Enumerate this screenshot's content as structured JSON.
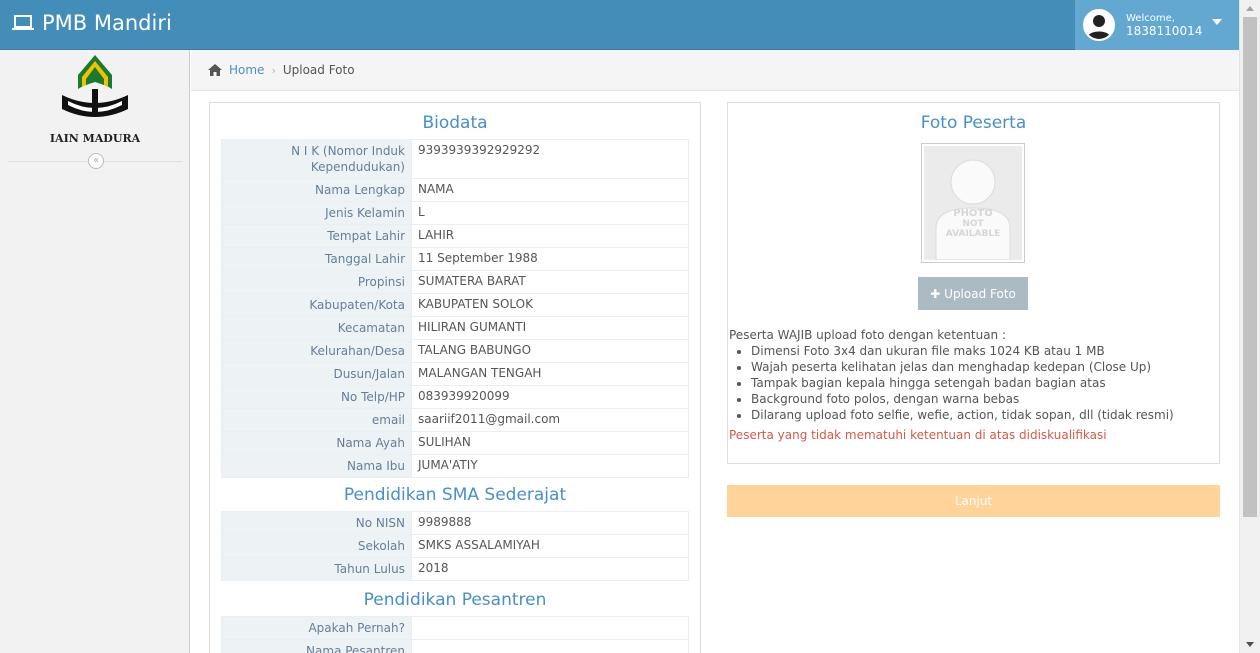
{
  "navbar": {
    "brand": "PMB Mandiri",
    "brand_icon": "laptop-icon",
    "welcome_label": "Welcome,",
    "username": "1838110014"
  },
  "sidebar": {
    "logo_text": "IAIN MADURA",
    "collapse_icon": "«"
  },
  "breadcrumb": {
    "home": "Home",
    "separator": "›",
    "current": "Upload Foto"
  },
  "biodata": {
    "title": "Biodata",
    "rows": [
      {
        "label": "N I K (Nomor Induk Kependudukan)",
        "value": "9393939392929292"
      },
      {
        "label": "Nama Lengkap",
        "value": "NAMA"
      },
      {
        "label": "Jenis Kelamin",
        "value": "L"
      },
      {
        "label": "Tempat Lahir",
        "value": "LAHIR"
      },
      {
        "label": "Tanggal Lahir",
        "value": "11 September 1988"
      },
      {
        "label": "Propinsi",
        "value": "SUMATERA BARAT"
      },
      {
        "label": "Kabupaten/Kota",
        "value": "KABUPATEN SOLOK"
      },
      {
        "label": "Kecamatan",
        "value": "HILIRAN GUMANTI"
      },
      {
        "label": "Kelurahan/Desa",
        "value": "TALANG BABUNGO"
      },
      {
        "label": "Dusun/Jalan",
        "value": "MALANGAN TENGAH"
      },
      {
        "label": "No Telp/HP",
        "value": "083939920099"
      },
      {
        "label": "email",
        "value": "saariif2011@gmail.com"
      },
      {
        "label": "Nama Ayah",
        "value": "SULIHAN"
      },
      {
        "label": "Nama Ibu",
        "value": "JUMA'ATIY"
      }
    ]
  },
  "sma": {
    "title": "Pendidikan SMA Sederajat",
    "rows": [
      {
        "label": "No NISN",
        "value": "9989888"
      },
      {
        "label": "Sekolah",
        "value": "SMKS ASSALAMIYAH"
      },
      {
        "label": "Tahun Lulus",
        "value": "2018"
      }
    ]
  },
  "pesantren": {
    "title": "Pendidikan Pesantren",
    "rows": [
      {
        "label": "Apakah Pernah?",
        "value": ""
      },
      {
        "label": "Nama Pesantren",
        "value": ""
      }
    ]
  },
  "foto": {
    "title": "Foto Peserta",
    "placeholder_text": [
      "PHOTO",
      "NOT",
      "AVAILABLE"
    ],
    "upload_button": "Upload Foto",
    "rules_intro": "Peserta WAJIB upload foto dengan ketentuan :",
    "rules": [
      "Dimensi Foto 3x4 dan ukuran file maks 1024 KB atau 1 MB",
      "Wajah peserta kelihatan jelas dan menghadap kedepan (Close Up)",
      "Tampak bagian kepala hingga setengah badan bagian atas",
      "Background foto polos, dengan warna bebas",
      "Dilarang upload foto selfie, wefie, action, tidak sopan, dll (tidak resmi)"
    ],
    "warning": "Peserta yang tidak mematuhi ketentuan di atas didiskualifikasi"
  },
  "actions": {
    "lanjut": "Lanjut"
  },
  "colors": {
    "navbar": "#438eb9",
    "user_area": "#62a8d1",
    "title_blue": "#478fca",
    "warning_red": "#d15b47",
    "lanjut_bg": "#ffd399",
    "upload_bg": "#abbac3"
  }
}
